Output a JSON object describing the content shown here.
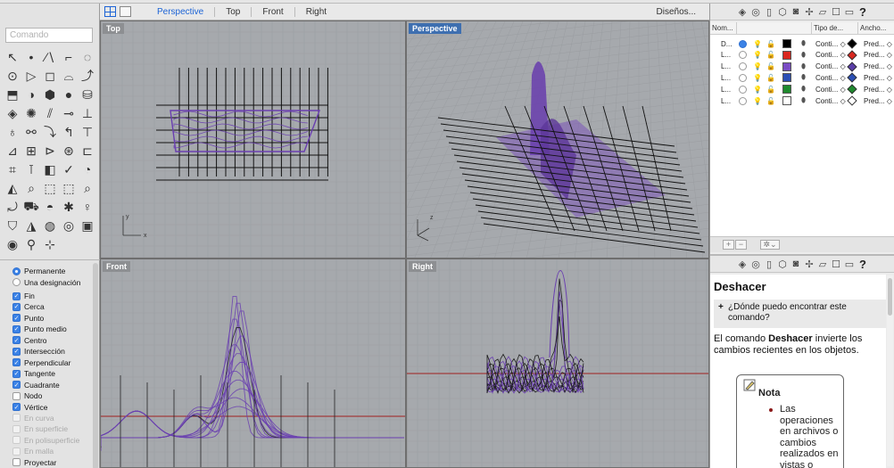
{
  "command_input": {
    "placeholder": "Comando"
  },
  "viewport_tabs": [
    {
      "label": "Perspective",
      "active": true
    },
    {
      "label": "Top",
      "active": false
    },
    {
      "label": "Front",
      "active": false
    },
    {
      "label": "Right",
      "active": false
    }
  ],
  "design_menu": "Diseños...",
  "viewports": {
    "top": {
      "label": "Top",
      "axis_y": "y",
      "axis_x": "x"
    },
    "perspective": {
      "label": "Perspective",
      "axis_z": "z"
    },
    "front": {
      "label": "Front"
    },
    "right": {
      "label": "Right"
    }
  },
  "osnaps": {
    "mode_options": [
      {
        "label": "Permanente",
        "selected": true
      },
      {
        "label": "Una designación",
        "selected": false
      }
    ],
    "items": [
      {
        "label": "Fin",
        "checked": true,
        "enabled": true
      },
      {
        "label": "Cerca",
        "checked": true,
        "enabled": true
      },
      {
        "label": "Punto",
        "checked": true,
        "enabled": true
      },
      {
        "label": "Punto medio",
        "checked": true,
        "enabled": true
      },
      {
        "label": "Centro",
        "checked": true,
        "enabled": true
      },
      {
        "label": "Intersección",
        "checked": true,
        "enabled": true
      },
      {
        "label": "Perpendicular",
        "checked": true,
        "enabled": true
      },
      {
        "label": "Tangente",
        "checked": true,
        "enabled": true
      },
      {
        "label": "Cuadrante",
        "checked": true,
        "enabled": true
      },
      {
        "label": "Nodo",
        "checked": false,
        "enabled": true
      },
      {
        "label": "Vértice",
        "checked": true,
        "enabled": true
      },
      {
        "label": "En curva",
        "checked": false,
        "enabled": false
      },
      {
        "label": "En superficie",
        "checked": false,
        "enabled": false
      },
      {
        "label": "En polisuperficie",
        "checked": false,
        "enabled": false
      },
      {
        "label": "En malla",
        "checked": false,
        "enabled": false
      },
      {
        "label": "Proyectar",
        "checked": false,
        "enabled": true
      }
    ]
  },
  "layers": {
    "headers": [
      "Nom...",
      "Tipo de...",
      "Ancho..."
    ],
    "rows": [
      {
        "name": "D...",
        "current": true,
        "color": "#000000",
        "linetype": "Conti... ◇",
        "print_color": "#000000",
        "width": "Pred... ◇"
      },
      {
        "name": "L...",
        "current": false,
        "color": "#d9271f",
        "linetype": "Conti... ◇",
        "print_color": "#d9271f",
        "width": "Pred... ◇"
      },
      {
        "name": "L...",
        "current": false,
        "color": "#7a4cc4",
        "linetype": "Conti... ◇",
        "print_color": "#5a3da8",
        "width": "Pred... ◇"
      },
      {
        "name": "L...",
        "current": false,
        "color": "#2b4fb5",
        "linetype": "Conti... ◇",
        "print_color": "#2b4fb5",
        "width": "Pred... ◇"
      },
      {
        "name": "L...",
        "current": false,
        "color": "#1f8a2e",
        "linetype": "Conti... ◇",
        "print_color": "#1f8a2e",
        "width": "Pred... ◇"
      },
      {
        "name": "L...",
        "current": false,
        "color": "#ffffff",
        "linetype": "Conti... ◇",
        "print_color": "#ffffff",
        "width": "Pred... ◇"
      }
    ]
  },
  "help": {
    "title": "Deshacer",
    "question": "¿Dónde puedo encontrar este comando?",
    "description_pre": "El comando ",
    "description_cmd": "Deshacer",
    "description_post": " invierte los cambios recientes en los objetos.",
    "note_title": "Nota",
    "note_text": "Las operaciones en archivos o cambios realizados en vistas o"
  },
  "colors": {
    "accent": "#1d64d6",
    "curve_purple": "#6a3fb0",
    "viewport_bg": "#a6a9ad",
    "x_axis": "#a02020"
  }
}
